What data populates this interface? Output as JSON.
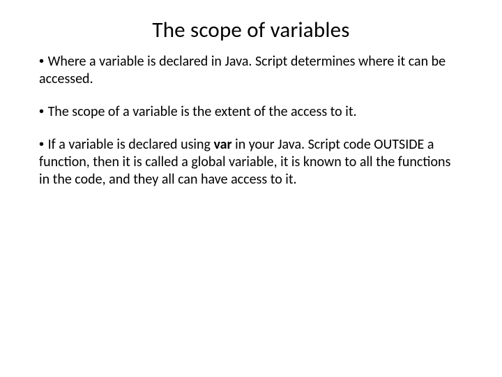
{
  "slide": {
    "title": "The scope of variables",
    "bullets": [
      {
        "prefix": "• ",
        "segments": [
          {
            "text": "Where a variable is declared in Java. Script determines where it can be accessed.",
            "bold": false
          }
        ]
      },
      {
        "prefix": "• ",
        "segments": [
          {
            "text": "The scope of a variable is the extent of the access to it.",
            "bold": false
          }
        ]
      },
      {
        "prefix": "• ",
        "segments": [
          {
            "text": "If a variable is declared using ",
            "bold": false
          },
          {
            "text": "var",
            "bold": true
          },
          {
            "text": " in your Java. Script code OUTSIDE a function, then it is called a global variable, it is known to all the functions in the code, and they all can have access to it.",
            "bold": false
          }
        ]
      }
    ]
  }
}
